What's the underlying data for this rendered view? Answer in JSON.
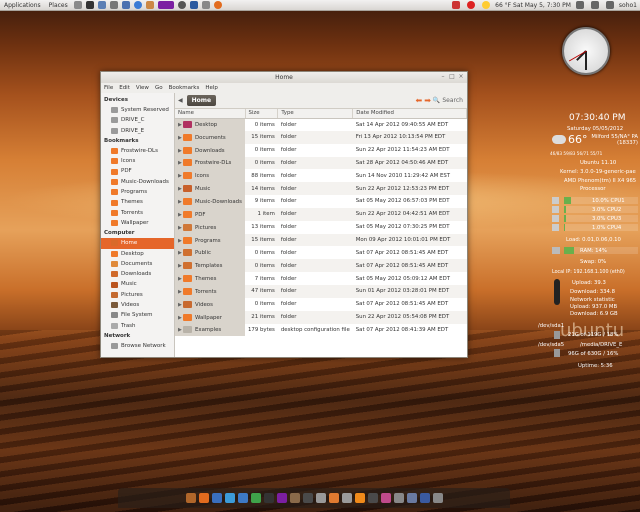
{
  "top_panel": {
    "menus": [
      "Applications",
      "Places"
    ],
    "clock": "66 °F  Sat May  5, 7:30 PM",
    "user": "soho1"
  },
  "window": {
    "title": "Home",
    "menu": [
      "File",
      "Edit",
      "View",
      "Go",
      "Bookmarks",
      "Help"
    ],
    "breadcrumb": "Home",
    "search_label": "Search"
  },
  "sidebar": {
    "devices_heading": "Devices",
    "devices": [
      "System Reserved",
      "DRIVE_C",
      "DRIVE_E"
    ],
    "bookmarks_heading": "Bookmarks",
    "bookmarks": [
      "Frostwire-DLs",
      "Icons",
      "PDF",
      "Music-Downloads",
      "Programs",
      "Themes",
      "Torrents",
      "Wallpaper"
    ],
    "computer_heading": "Computer",
    "computer": [
      "Home",
      "Desktop",
      "Documents",
      "Downloads",
      "Music",
      "Pictures",
      "Videos",
      "File System",
      "Trash"
    ],
    "network_heading": "Network",
    "network": [
      "Browse Network"
    ]
  },
  "columns": {
    "name": "Name",
    "size": "Size",
    "type": "Type",
    "date": "Date Modified"
  },
  "files": [
    {
      "name": "Desktop",
      "size": "0 items",
      "type": "folder",
      "date": "Sat 14 Apr 2012 09:40:55 AM EDT"
    },
    {
      "name": "Documents",
      "size": "15 items",
      "type": "folder",
      "date": "Fri 13 Apr 2012 10:13:54 PM EDT"
    },
    {
      "name": "Downloads",
      "size": "0 items",
      "type": "folder",
      "date": "Sun 22 Apr 2012 11:54:23 AM EDT"
    },
    {
      "name": "Frostwire-DLs",
      "size": "0 items",
      "type": "folder",
      "date": "Sat 28 Apr 2012 04:50:46 AM EDT"
    },
    {
      "name": "Icons",
      "size": "88 items",
      "type": "folder",
      "date": "Sun 14 Nov 2010 11:29:42 AM EST"
    },
    {
      "name": "Music",
      "size": "14 items",
      "type": "folder",
      "date": "Sun 22 Apr 2012 12:53:23 PM EDT"
    },
    {
      "name": "Music-Downloads",
      "size": "9 items",
      "type": "folder",
      "date": "Sat 05 May 2012 06:57:03 PM EDT"
    },
    {
      "name": "PDF",
      "size": "1 item",
      "type": "folder",
      "date": "Sun 22 Apr 2012 04:42:51 AM EDT"
    },
    {
      "name": "Pictures",
      "size": "13 items",
      "type": "folder",
      "date": "Sat 05 May 2012 07:30:25 PM EDT"
    },
    {
      "name": "Programs",
      "size": "15 items",
      "type": "folder",
      "date": "Mon 09 Apr 2012 10:01:01 PM EDT"
    },
    {
      "name": "Public",
      "size": "0 items",
      "type": "folder",
      "date": "Sat 07 Apr 2012 08:51:45 AM EDT"
    },
    {
      "name": "Templates",
      "size": "0 items",
      "type": "folder",
      "date": "Sat 07 Apr 2012 08:51:45 AM EDT"
    },
    {
      "name": "Themes",
      "size": "7 items",
      "type": "folder",
      "date": "Sat 05 May 2012 05:09:12 AM EDT"
    },
    {
      "name": "Torrents",
      "size": "47 items",
      "type": "folder",
      "date": "Sun 01 Apr 2012 03:28:01 PM EDT"
    },
    {
      "name": "Videos",
      "size": "0 items",
      "type": "folder",
      "date": "Sat 07 Apr 2012 08:51:45 AM EDT"
    },
    {
      "name": "Wallpaper",
      "size": "21 items",
      "type": "folder",
      "date": "Sun 22 Apr 2012 05:54:08 PM EDT"
    },
    {
      "name": "Examples",
      "size": "179 bytes",
      "type": "desktop configuration file",
      "date": "Sat 07 Apr 2012 08:41:39 AM EDT"
    }
  ],
  "conky": {
    "time": "07:30:40 PM",
    "date": "Saturday 05/05/2012",
    "temp": "66°",
    "location": "Milford 55/NA° PA (18337)",
    "forecast": "46/83  59/83  56/71  55/71",
    "os": "Ubuntu 11.10",
    "kernel": "Kernel: 3.0.0-19-generic-pae",
    "cpu_model": "AMD Phenom(tm) II X4 965",
    "processor": "Processor",
    "cpus": [
      {
        "label": "10.0% CPU1",
        "pct": 10
      },
      {
        "label": "3.0% CPU2",
        "pct": 3
      },
      {
        "label": "3.0% CPU3",
        "pct": 3
      },
      {
        "label": "1.0% CPU4",
        "pct": 1
      }
    ],
    "load": "Load: 0.01,0.06,0.10",
    "ram": "RAM: 14%",
    "ram_pct": 14,
    "swap": "Swap: 0%",
    "ip": "Local IP: 192.168.1.100 (eth0)",
    "upload": "Upload: 39.3",
    "download": "Download: 334.8",
    "netstat": "Network statistic",
    "upload_total": "Upload: 937.0 MB",
    "download_total": "Download: 6.9 GB",
    "disk1_name": "/dev/sda1",
    "disk1": "21G of 119G / 18%",
    "disk2_name": "/dev/sda5",
    "disk2_path": "/media/DRIVE_E",
    "disk2": "96G of 630G / 16%",
    "uptime": "Uptime: 5:36"
  },
  "wallpaper_text": "ubuntu",
  "colors": {
    "accent": "#e5662a",
    "folder": "#f07a2a"
  }
}
